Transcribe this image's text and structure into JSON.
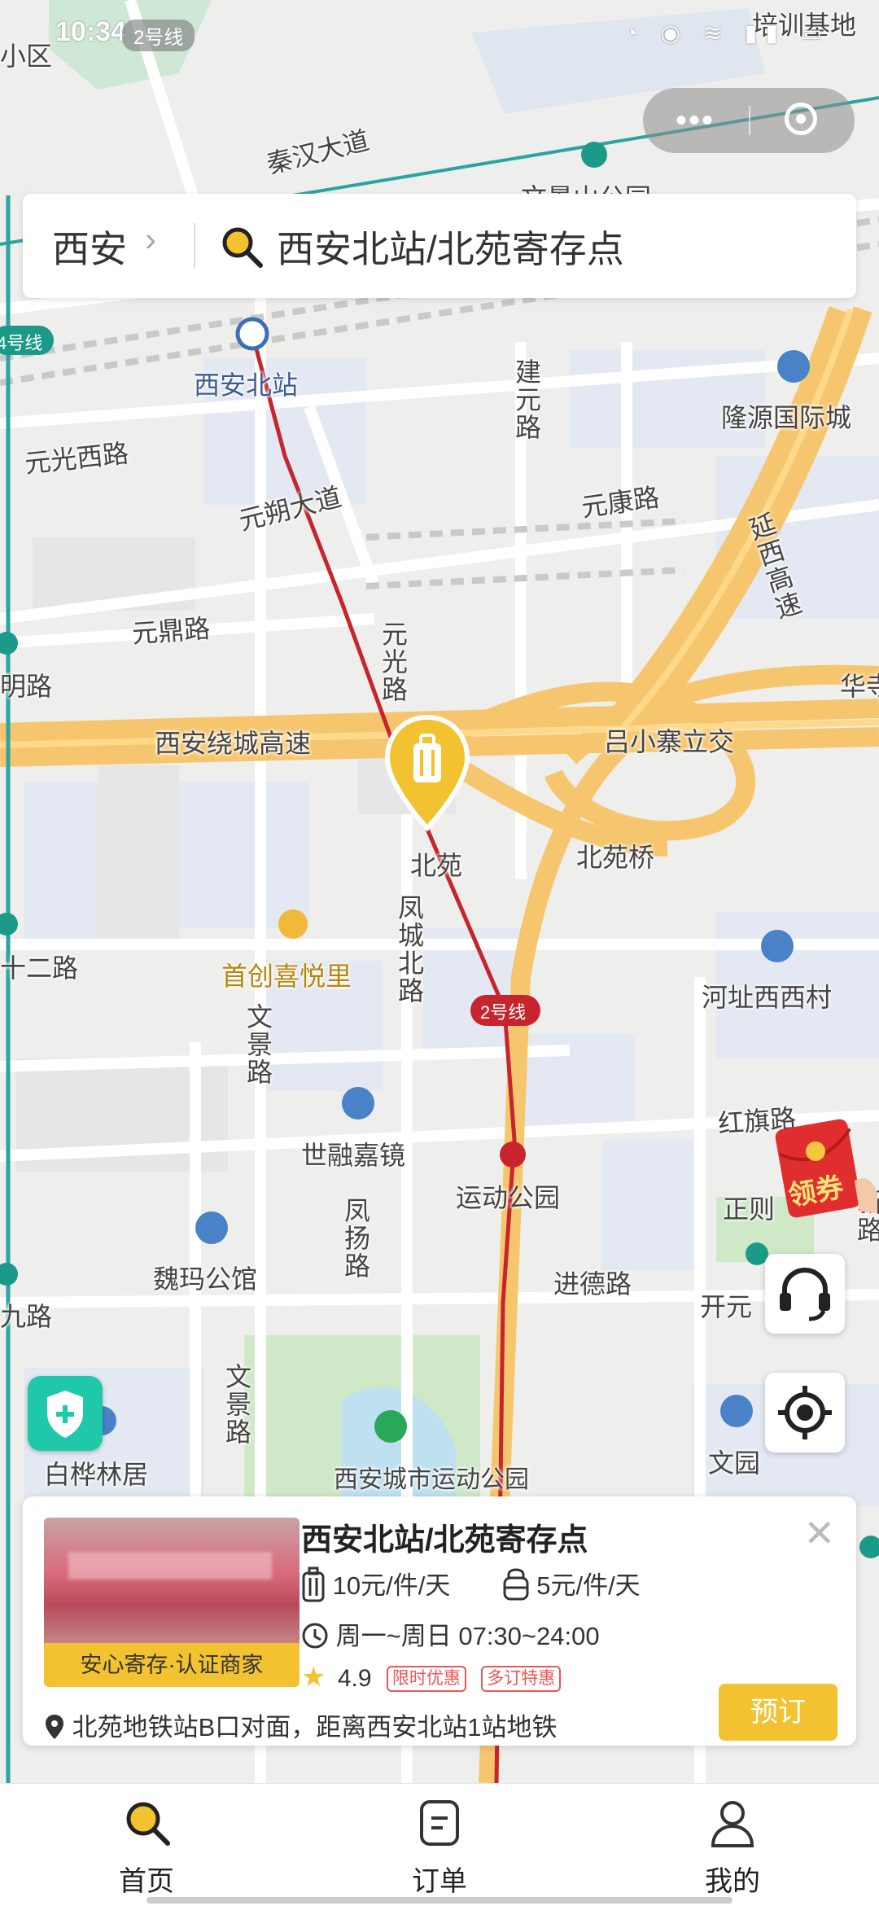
{
  "status_bar": {
    "time": "10:34",
    "route_label": "2号线"
  },
  "search": {
    "city": "西安",
    "query": "西安北站/北苑寄存点"
  },
  "map": {
    "labels": {
      "qinhan": "秦汉大道",
      "wenjing_park": "文景山公园",
      "xian_north": "西安北站",
      "jianyuan": "建元路",
      "longyuan": "隆源国际城",
      "yuanguang_west": "元光西路",
      "yuanshuo": "元朔大道",
      "yuankang": "元康路",
      "yanxi": "延西高速",
      "yuanding": "元鼎路",
      "yuanguang": "元光路",
      "ring": "西安绕城高速",
      "lvxiaozhai": "吕小寨立交",
      "huaxia": "华寺",
      "beiyuan": "北苑",
      "beiyuan_bridge": "北苑桥",
      "fengcheng": "凤城北路",
      "shouchuang": "首创喜悦里",
      "hezhi": "河址西西村",
      "line2": "2号线",
      "wenjing_road": "文景路",
      "hongqi": "红旗路",
      "shirong": "世融嘉镜",
      "yundong": "运动公园",
      "fengyang": "凤扬路",
      "weima": "魏玛公馆",
      "jinde": "进德路",
      "zhengji": "正则",
      "kaiyuan": "开元",
      "xinlu": "新路",
      "baihua": "白桦林居",
      "city_park": "西安城市运动公园",
      "wenyuan": "文园",
      "line4": "4号线",
      "shierlu": "十二路",
      "jiulu": "九路",
      "xiaoqu": "小区",
      "peixun": "培训基地",
      "mingtu": "明路"
    }
  },
  "coupon": {
    "label": "领券"
  },
  "card": {
    "title": "西安北站/北苑寄存点",
    "badge": "安心寄存·认证商家",
    "price_large": "10元/件/天",
    "price_small": "5元/件/天",
    "hours": "周一~周日 07:30~24:00",
    "rating": "4.9",
    "tags": [
      "限时优惠",
      "多订特惠"
    ],
    "address": "北苑地铁站B口对面，距离西安北站1站地铁",
    "book_label": "预订"
  },
  "tabs": [
    {
      "label": "首页",
      "icon": "search-icon"
    },
    {
      "label": "订单",
      "icon": "order-icon"
    },
    {
      "label": "我的",
      "icon": "profile-icon"
    }
  ],
  "colors": {
    "accent": "#F2C230",
    "metro_line2": "#C8242E",
    "road": "#F6C66E",
    "water_green": "#1FC8A8"
  }
}
